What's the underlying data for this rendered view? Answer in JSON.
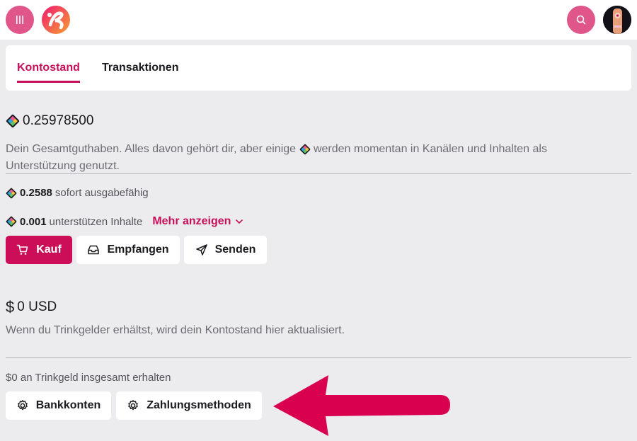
{
  "header": {
    "menu_icon": "menu-icon",
    "logo_icon": "odysee-logo",
    "search_icon": "search-icon",
    "avatar_icon": "user-avatar"
  },
  "tabs": [
    {
      "label": "Kontostand",
      "active": true
    },
    {
      "label": "Transaktionen",
      "active": false
    }
  ],
  "credits": {
    "icon": "lbc-credit-icon",
    "total": "0.25978500",
    "description": "Dein Gesamtguthaben. Alles davon gehört dir, aber einige",
    "description_tail": "werden momentan in Kanälen und Inhalten als Unterstützung genutzt.",
    "available_amount": "0.2588",
    "available_label": "sofort ausgabefähig",
    "supporting_amount": "0.001",
    "supporting_label": "unterstützen Inhalte",
    "more_label": "Mehr anzeigen"
  },
  "actions": {
    "buy_label": "Kauf",
    "receive_label": "Empfangen",
    "send_label": "Senden"
  },
  "usd": {
    "currency_symbol": "$",
    "amount": "0 USD",
    "description": "Wenn du Trinkgelder erhältst, wird dein Kontostand hier aktualisiert.",
    "tips_total": "$0 an Trinkgeld insgesamt erhalten",
    "bank_label": "Bankkonten",
    "payment_label": "Zahlungsmethoden"
  },
  "colors": {
    "accent": "#cc0d57",
    "round_button": "#e0568a",
    "annotation_arrow": "#d8004f"
  }
}
